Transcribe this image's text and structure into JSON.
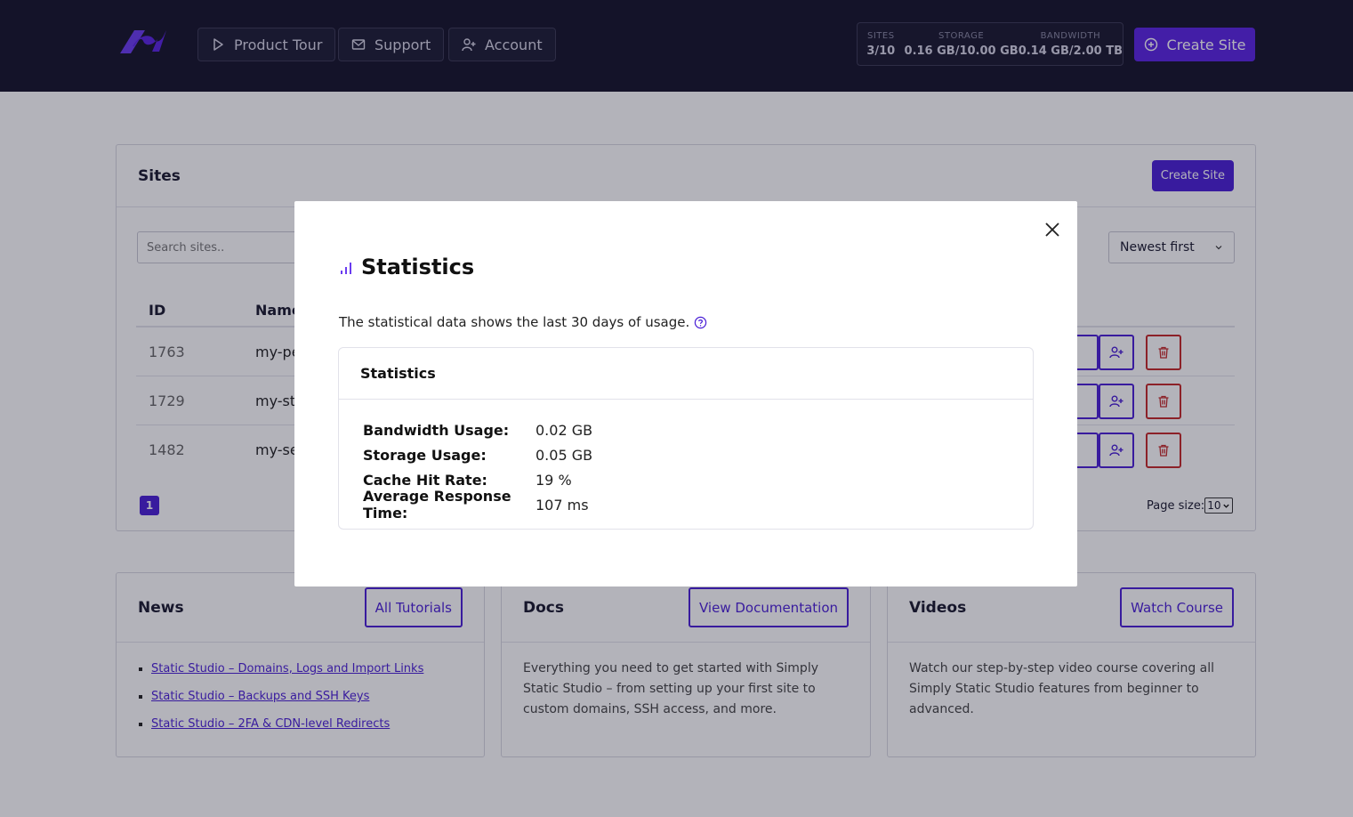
{
  "header": {
    "product_tour": "Product Tour",
    "support": "Support",
    "account": "Account",
    "stats": {
      "sites_label": "SITES",
      "sites_value": "3/10",
      "storage_label": "STORAGE",
      "storage_value": "0.16 GB/10.00 GB",
      "bandwidth_label": "BANDWIDTH",
      "bandwidth_value": "0.14 GB/2.00 TB"
    },
    "create_site": "Create Site"
  },
  "sites": {
    "title": "Sites",
    "create_button": "Create Site",
    "search_placeholder": "Search sites..",
    "sort_value": "Newest first",
    "columns": {
      "id": "ID",
      "name": "Name"
    },
    "rows": [
      {
        "id": "1763",
        "name": "my-pe"
      },
      {
        "id": "1729",
        "name": "my-sta"
      },
      {
        "id": "1482",
        "name": "my-se"
      }
    ],
    "page": "1",
    "page_size_label": "Page size:",
    "page_size_value": "10"
  },
  "news": {
    "title": "News",
    "button": "All Tutorials",
    "items": [
      "Static Studio – Domains, Logs and Import Links",
      "Static Studio – Backups and SSH Keys",
      "Static Studio – 2FA & CDN-level Redirects"
    ]
  },
  "docs": {
    "title": "Docs",
    "button": "View Documentation",
    "text": "Everything you need to get started with Simply Static Studio – from setting up your first site to custom domains, SSH access, and more."
  },
  "videos": {
    "title": "Videos",
    "button": "Watch Course",
    "text": "Watch our step-by-step video course covering all Simply Static Studio features from beginner to advanced."
  },
  "modal": {
    "title": "Statistics",
    "description": "The statistical data shows the last 30 days of usage.",
    "panel_title": "Statistics",
    "stats": [
      {
        "label": "Bandwidth Usage:",
        "value": "0.02 GB"
      },
      {
        "label": "Storage Usage:",
        "value": "0.05 GB"
      },
      {
        "label": "Cache Hit Rate:",
        "value": "19 %"
      },
      {
        "label": "Average Response Time:",
        "value": "107 ms"
      }
    ]
  },
  "colors": {
    "accent": "#4a1fd6",
    "danger": "#c62828",
    "header_bg": "#15142a"
  }
}
